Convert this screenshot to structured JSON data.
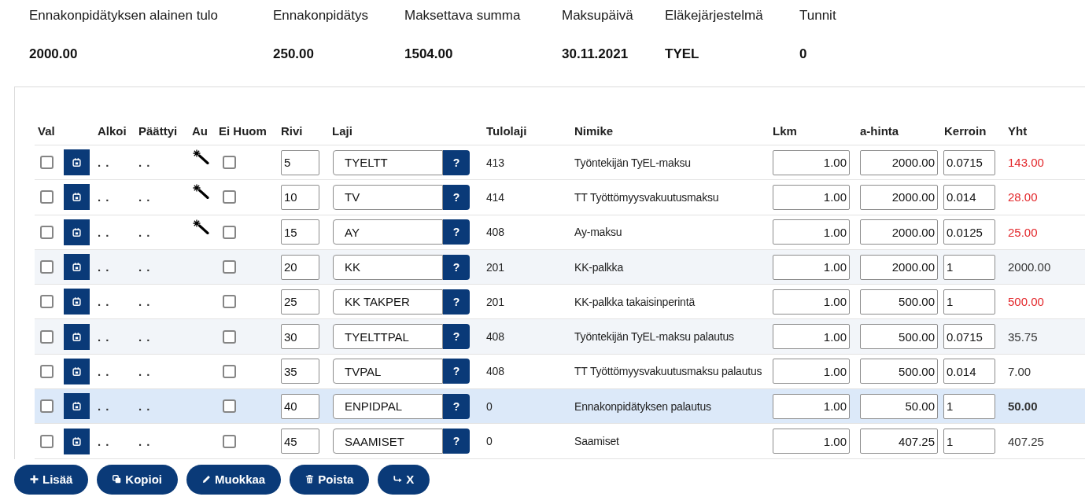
{
  "summary": [
    {
      "label": "Ennakonpidätyksen alainen tulo",
      "value": "2000.00"
    },
    {
      "label": "Ennakonpidätys",
      "value": "250.00"
    },
    {
      "label": "Maksettava summa",
      "value": "1504.00"
    },
    {
      "label": "Maksupäivä",
      "value": "30.11.2021"
    },
    {
      "label": "Eläkejärjestelmä",
      "value": "TYEL"
    },
    {
      "label": "Tunnit",
      "value": "0"
    }
  ],
  "table": {
    "columns": [
      "Val",
      "Alkoi",
      "Päättyi",
      "Au",
      "Ei Huom",
      "Rivi",
      "Laji",
      "Tulolaji",
      "Nimike",
      "Lkm",
      "a-hinta",
      "Kerroin",
      "Yht"
    ],
    "rows": [
      {
        "selected": false,
        "shaded": false,
        "checked": false,
        "alkoi": ". .",
        "paattyi": ". .",
        "auto": true,
        "ei_huom": false,
        "rivi": {
          "value": "5"
        },
        "laji": {
          "value": "TYELTT"
        },
        "lookup": "?",
        "tulolaji": "413",
        "nimike": "Työntekijän TyEL-maksu",
        "lkm": {
          "value": "1.00"
        },
        "a_hinta": {
          "value": "2000.00"
        },
        "kerroin": {
          "value": "0.0715"
        },
        "yht": "143.00",
        "deduction": true
      },
      {
        "selected": false,
        "shaded": false,
        "checked": false,
        "alkoi": ". .",
        "paattyi": ". .",
        "auto": true,
        "ei_huom": false,
        "rivi": {
          "value": "10"
        },
        "laji": {
          "value": "TV"
        },
        "lookup": "?",
        "tulolaji": "414",
        "nimike": "TT Työttömyysvakuutusmaksu",
        "lkm": {
          "value": "1.00"
        },
        "a_hinta": {
          "value": "2000.00"
        },
        "kerroin": {
          "value": "0.014"
        },
        "yht": "28.00",
        "deduction": true
      },
      {
        "selected": false,
        "shaded": false,
        "checked": false,
        "alkoi": ". .",
        "paattyi": ". .",
        "auto": true,
        "ei_huom": false,
        "rivi": {
          "value": "15"
        },
        "laji": {
          "value": "AY"
        },
        "lookup": "?",
        "tulolaji": "408",
        "nimike": "Ay-maksu",
        "lkm": {
          "value": "1.00"
        },
        "a_hinta": {
          "value": "2000.00"
        },
        "kerroin": {
          "value": "0.0125"
        },
        "yht": "25.00",
        "deduction": true
      },
      {
        "selected": false,
        "shaded": true,
        "checked": false,
        "alkoi": ". .",
        "paattyi": ". .",
        "auto": false,
        "ei_huom": false,
        "rivi": {
          "value": "20"
        },
        "laji": {
          "value": "KK"
        },
        "lookup": "?",
        "tulolaji": "201",
        "nimike": "KK-palkka",
        "lkm": {
          "value": "1.00"
        },
        "a_hinta": {
          "value": "2000.00"
        },
        "kerroin": {
          "value": "1"
        },
        "yht": "2000.00",
        "deduction": false
      },
      {
        "selected": false,
        "shaded": false,
        "checked": false,
        "alkoi": ". .",
        "paattyi": ". .",
        "auto": false,
        "ei_huom": false,
        "rivi": {
          "value": "25"
        },
        "laji": {
          "value": "KK TAKPER"
        },
        "lookup": "?",
        "tulolaji": "201",
        "nimike": "KK-palkka takaisinperintä",
        "lkm": {
          "value": "1.00"
        },
        "a_hinta": {
          "value": "500.00"
        },
        "kerroin": {
          "value": "1"
        },
        "yht": "500.00",
        "deduction": true
      },
      {
        "selected": false,
        "shaded": true,
        "checked": false,
        "alkoi": ". .",
        "paattyi": ". .",
        "auto": false,
        "ei_huom": false,
        "rivi": {
          "value": "30"
        },
        "laji": {
          "value": "TYELTTPAL"
        },
        "lookup": "?",
        "tulolaji": "408",
        "nimike": "Työntekijän TyEL-maksu palautus",
        "lkm": {
          "value": "1.00"
        },
        "a_hinta": {
          "value": "500.00"
        },
        "kerroin": {
          "value": "0.0715"
        },
        "yht": "35.75",
        "deduction": false
      },
      {
        "selected": false,
        "shaded": false,
        "checked": false,
        "alkoi": ". .",
        "paattyi": ". .",
        "auto": false,
        "ei_huom": false,
        "rivi": {
          "value": "35"
        },
        "laji": {
          "value": "TVPAL"
        },
        "lookup": "?",
        "tulolaji": "408",
        "nimike": "TT Työttömyysvakuutusmaksu palautus",
        "lkm": {
          "value": "1.00"
        },
        "a_hinta": {
          "value": "500.00"
        },
        "kerroin": {
          "value": "0.014"
        },
        "yht": "7.00",
        "deduction": false
      },
      {
        "selected": true,
        "shaded": false,
        "checked": false,
        "alkoi": ". .",
        "paattyi": ". .",
        "auto": false,
        "ei_huom": false,
        "rivi": {
          "value": "40"
        },
        "laji": {
          "value": "ENPIDPAL"
        },
        "lookup": "?",
        "tulolaji": "0",
        "nimike": "Ennakonpidätyksen palautus",
        "lkm": {
          "value": "1.00"
        },
        "a_hinta": {
          "value": "50.00"
        },
        "kerroin": {
          "value": "1"
        },
        "yht": "50.00",
        "deduction": false
      },
      {
        "selected": false,
        "shaded": false,
        "checked": false,
        "alkoi": ". .",
        "paattyi": ". .",
        "auto": false,
        "ei_huom": false,
        "rivi": {
          "value": "45"
        },
        "laji": {
          "value": "SAAMISET"
        },
        "lookup": "?",
        "tulolaji": "0",
        "nimike": "Saamiset",
        "lkm": {
          "value": "1.00"
        },
        "a_hinta": {
          "value": "407.25"
        },
        "kerroin": {
          "value": "1"
        },
        "yht": "407.25",
        "deduction": false
      }
    ]
  },
  "buttons": [
    {
      "kind": "add",
      "label": "Lisää"
    },
    {
      "kind": "copy",
      "label": "Kopioi"
    },
    {
      "kind": "edit",
      "label": "Muokkaa"
    },
    {
      "kind": "delete",
      "label": "Poista"
    },
    {
      "kind": "return",
      "label": "X"
    }
  ]
}
